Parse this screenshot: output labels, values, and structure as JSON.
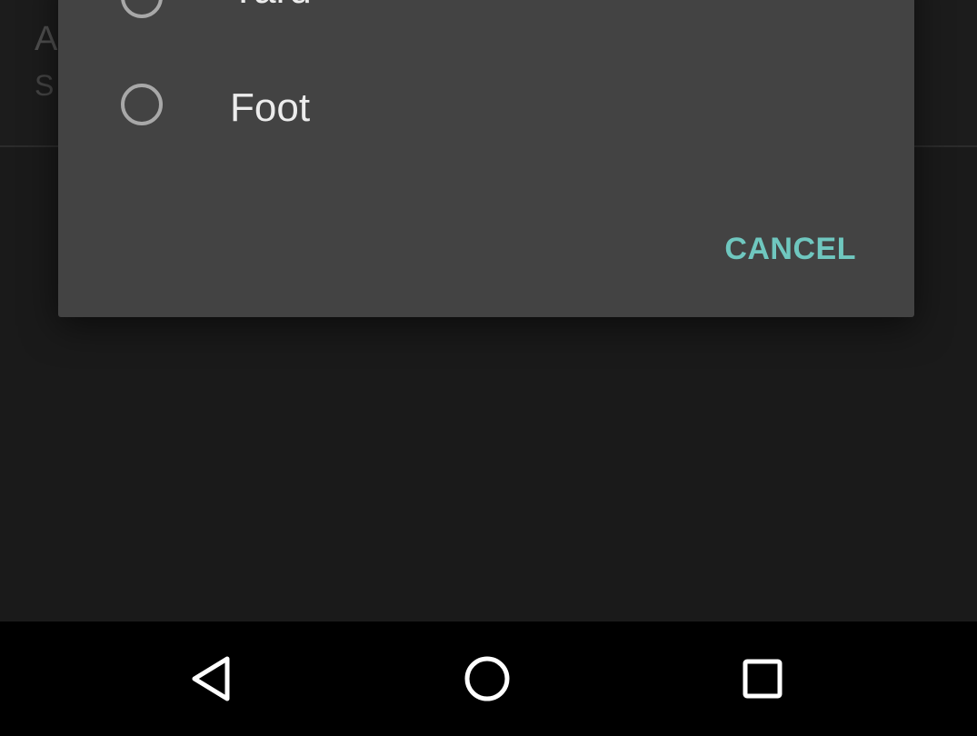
{
  "background": {
    "title": "A",
    "summary": "S"
  },
  "dialog": {
    "options": [
      {
        "label": "Yard",
        "selected": false
      },
      {
        "label": "Foot",
        "selected": false
      }
    ],
    "cancel_label": "CANCEL"
  },
  "nav_bar": {
    "back_icon": "back-triangle-icon",
    "home_icon": "home-circle-icon",
    "recents_icon": "recents-square-icon"
  },
  "colors": {
    "accent": "#6fc7bf",
    "dialog_bg": "#434343",
    "screen_bg": "#1a1a1a",
    "nav_bg": "#000000"
  }
}
